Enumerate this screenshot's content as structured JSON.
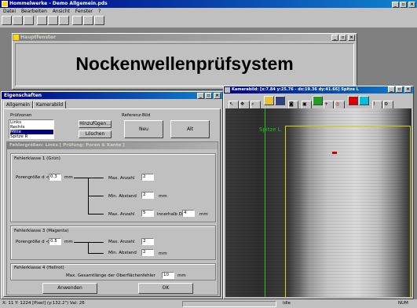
{
  "app": {
    "title": "Hommelwerke - Demo Allgemein.pds",
    "menu": [
      "Datei",
      "Bearbeiten",
      "Ansicht",
      "Fenster",
      "?"
    ]
  },
  "main_window": {
    "title": "Hauptfenster",
    "heading": "Nockenwellenprüfsystem"
  },
  "properties": {
    "title": "Eigenschaften",
    "tabs": [
      "Allgemein",
      "Kamerabild"
    ],
    "pruefzonen_label": "Prüfzonen",
    "zones": [
      "Links",
      "Rechts",
      "Mitte",
      "Spitze R"
    ],
    "selected_zone_index": 2,
    "add_button": "Hinzufügen...",
    "delete_button": "Löschen",
    "referenz_label": "Referenz-Bild",
    "neu_button": "Neu",
    "alt_button": "Alt",
    "fehlergroessen_title": "Fehlergrößen: Links [ Prüfung: Poren & Kante ]",
    "class1": {
      "title": "Fehlerklasse 1 (Grün)",
      "pore_label": "Porengröße d <=",
      "pore_value": "0.3",
      "unit_mm": "mm",
      "max_anzahl_label": "Max. Anzahl",
      "max_anzahl_value": "2",
      "min_abstand_label": "Min. Abstand",
      "min_abstand_value": "2",
      "max_anzahl2_label": "Max. Anzahl",
      "max_anzahl2_value": "5",
      "innerhalb_label": "innerhalb D=",
      "innerhalb_value": "4"
    },
    "class3": {
      "title": "Fehlerklasse 3 (Magenta)",
      "pore_label": "Porengröße d <=",
      "pore_value": "0.5",
      "max_anzahl_label": "Max. Anzahl",
      "max_anzahl_value": "2",
      "min_abstand_label": "Min. Abstand",
      "min_abstand_value": "2"
    },
    "class4": {
      "title": "Fehlerklasse 4 (Hellrot)",
      "gesamt_label": "Max. Gesamtlänge der Oberflächenfehler",
      "gesamt_value": "10"
    },
    "apply_button": "Anwenden",
    "ok_button": "OK"
  },
  "camera": {
    "title": "Kamerabild: [x:7.84 y:25.76 - dx:19.36 dy:41.66] Spitze L",
    "label_overlay": "Spitze L",
    "tool_icons": [
      "arrow-icon",
      "move-icon",
      "zoom-icon",
      "open-icon",
      "save-icon",
      "camera-icon",
      "image-icon",
      "bars-icon",
      "cross-icon",
      "circle-icon",
      "red-box-icon",
      "cyan-box-icon",
      "graph-icon",
      "gear-icon"
    ]
  },
  "statusbar": {
    "coords": "X: 11 Y: 1224 [Pixel] (y:132.2\") Val: 26",
    "state": "Idle",
    "num": "NUM"
  },
  "colors": {
    "title_active": "#000080",
    "title_inactive": "#808080",
    "window_bg": "#c0c0c0",
    "overlay_green": "#1fbf1f",
    "overlay_yellow": "#d8d800"
  }
}
